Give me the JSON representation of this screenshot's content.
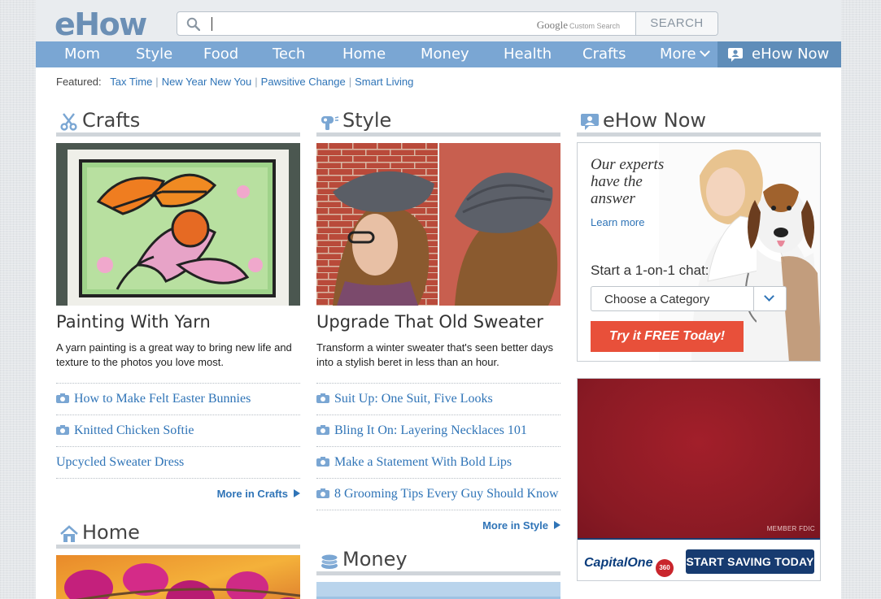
{
  "brand": {
    "logo": "eHow",
    "accent": "#7aa6d3",
    "link_color": "#2f74b7"
  },
  "search": {
    "placeholder": "",
    "google_label": "Google",
    "custom_search_label": "Custom Search",
    "button_label": "SEARCH"
  },
  "nav": {
    "items": [
      "Mom",
      "Style",
      "Food",
      "Tech",
      "Home",
      "Money",
      "Health",
      "Crafts",
      "More"
    ],
    "now_label": "eHow Now"
  },
  "featured": {
    "label": "Featured:",
    "links": [
      "Tax Time",
      "New Year New You",
      "Pawsitive Change",
      "Smart Living"
    ]
  },
  "crafts": {
    "section_title": "Crafts",
    "article_title": "Painting With Yarn",
    "article_desc": "A yarn painting is a great way to bring new life and texture to the photos you love most.",
    "links": [
      {
        "text": "How to Make Felt Easter Bunnies",
        "icon": "camera-icon"
      },
      {
        "text": "Knitted Chicken Softie",
        "icon": "camera-icon"
      },
      {
        "text": "Upcycled Sweater Dress",
        "icon": ""
      }
    ],
    "more": "More in Crafts"
  },
  "style": {
    "section_title": "Style",
    "article_title": "Upgrade That Old Sweater",
    "article_desc": "Transform a winter sweater that's seen better days into a stylish beret in less than an hour.",
    "links": [
      {
        "text": "Suit Up: One Suit, Five Looks",
        "icon": "camera-icon"
      },
      {
        "text": "Bling It On: Layering Necklaces 101",
        "icon": "camera-icon"
      },
      {
        "text": "Make a Statement With Bold Lips",
        "icon": "camera-icon"
      },
      {
        "text": "8 Grooming Tips Every Guy Should Know",
        "icon": "camera-icon"
      }
    ],
    "more": "More in Style"
  },
  "home": {
    "section_title": "Home"
  },
  "money": {
    "section_title": "Money"
  },
  "ehow_now": {
    "section_title": "eHow Now",
    "tagline": "Our experts have the answer",
    "learn_more": "Learn more",
    "chat_label": "Start a 1-on-1 chat:",
    "category_value": "Choose a Category",
    "cta": "Try it FREE Today!"
  },
  "ad": {
    "fdic": "MEMBER FDIC",
    "brand": "CapitalOne",
    "badge": "360",
    "button": "START SAVING TODAY",
    "color": "#8a1a24"
  }
}
